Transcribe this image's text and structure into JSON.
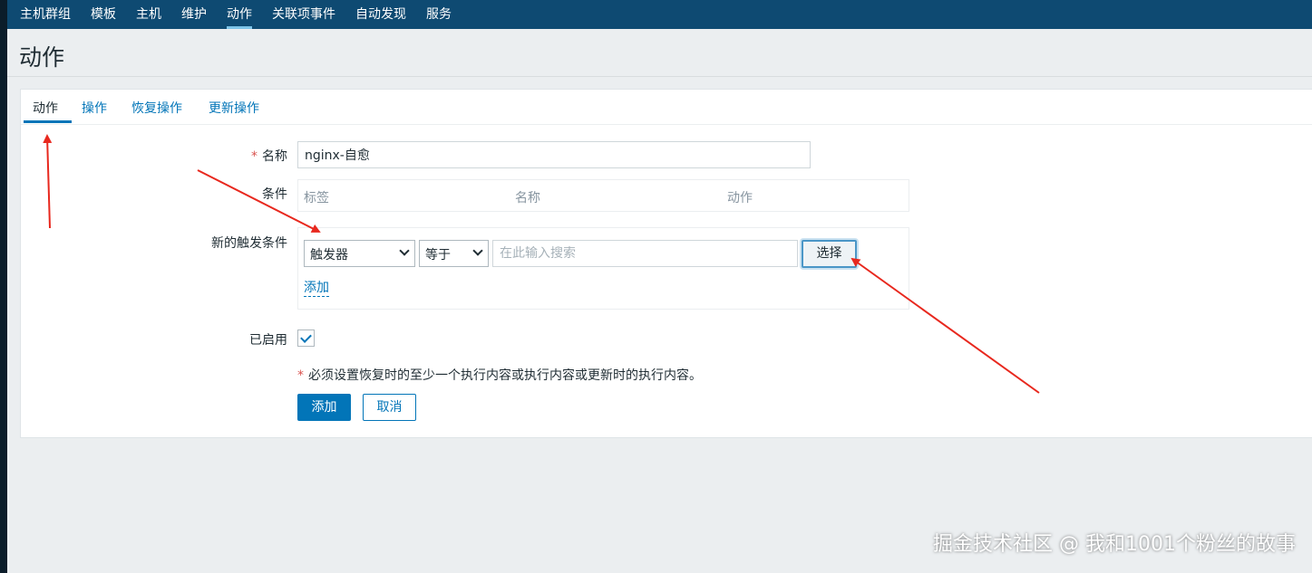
{
  "topnav": {
    "items": [
      {
        "label": "主机群组"
      },
      {
        "label": "模板"
      },
      {
        "label": "主机"
      },
      {
        "label": "维护"
      },
      {
        "label": "动作",
        "active": true
      },
      {
        "label": "关联项事件"
      },
      {
        "label": "自动发现"
      },
      {
        "label": "服务"
      }
    ]
  },
  "page": {
    "title": "动作"
  },
  "tabs": [
    {
      "label": "动作",
      "active": true
    },
    {
      "label": "操作"
    },
    {
      "label": "恢复操作"
    },
    {
      "label": "更新操作"
    }
  ],
  "form": {
    "name_label": "名称",
    "required_mark": "*",
    "name_value": "nginx-自愈",
    "conditions_label": "条件",
    "conditions_columns": [
      "标签",
      "名称",
      "动作"
    ],
    "new_condition_label": "新的触发条件",
    "condition_type_value": "触发器",
    "operator_value": "等于",
    "search_placeholder": "在此输入搜索",
    "select_button": "选择",
    "add_link": "添加",
    "enabled_label": "已启用",
    "enabled": true,
    "note": "必须设置恢复时的至少一个执行内容或执行内容或更新时的执行内容。",
    "submit_button": "添加",
    "cancel_button": "取消"
  },
  "watermark": "掘金技术社区 @ 我和1001个粉丝的故事",
  "colors": {
    "nav_bg": "#0e4a72",
    "accent": "#0275b8",
    "annotation_arrow": "#e8281e"
  }
}
